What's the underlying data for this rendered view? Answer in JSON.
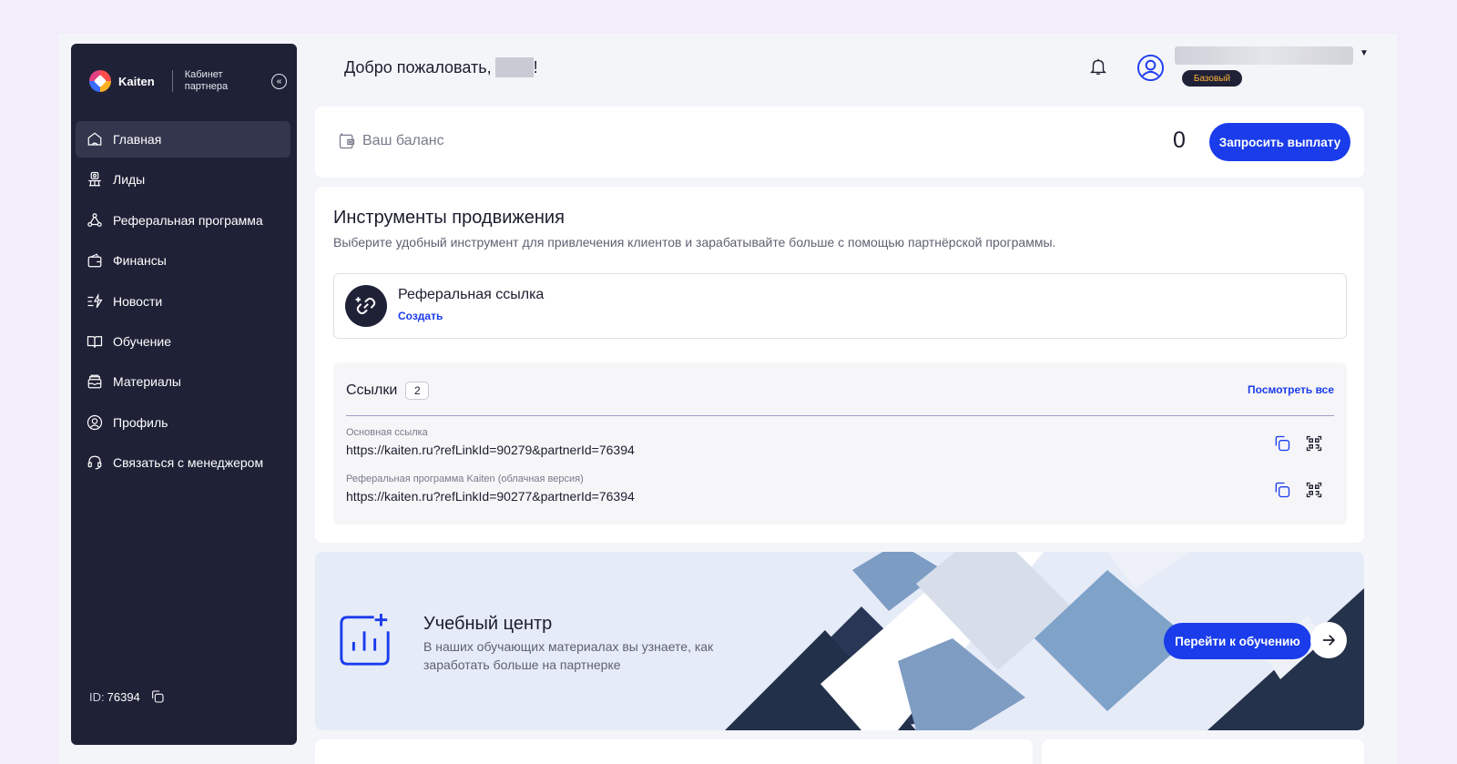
{
  "brand": {
    "name": "Kaiten",
    "subtitle": "Кабинет партнера"
  },
  "sidebar": {
    "items": [
      {
        "label": "Главная",
        "icon": "home-icon"
      },
      {
        "label": "Лиды",
        "icon": "leads-icon"
      },
      {
        "label": "Реферальная программа",
        "icon": "referral-icon"
      },
      {
        "label": "Финансы",
        "icon": "wallet-icon"
      },
      {
        "label": "Новости",
        "icon": "news-icon"
      },
      {
        "label": "Обучение",
        "icon": "book-icon"
      },
      {
        "label": "Материалы",
        "icon": "materials-icon"
      },
      {
        "label": "Профиль",
        "icon": "profile-icon"
      },
      {
        "label": "Связаться с менеджером",
        "icon": "headset-icon"
      }
    ],
    "id_label": "ID:",
    "id_value": "76394"
  },
  "header": {
    "welcome": "Добро пожаловать,",
    "welcome_suffix": "!",
    "plan": "Базовый"
  },
  "balance": {
    "label": "Ваш баланс",
    "value": "0",
    "payout_button": "Запросить выплату"
  },
  "tools": {
    "title": "Инструменты продвижения",
    "subtitle": "Выберите удобный инструмент для привлечения клиентов и зарабатывайте больше с помощью партнёрской программы.",
    "referral_link": {
      "title": "Реферальная ссылка",
      "action": "Создать"
    },
    "links": {
      "title": "Ссылки",
      "count": "2",
      "view_all": "Посмотреть все",
      "rows": [
        {
          "label": "Основная ссылка",
          "url": "https://kaiten.ru?refLinkId=90279&partnerId=76394"
        },
        {
          "label": "Реферальная программа Kaiten (облачная версия)",
          "url": "https://kaiten.ru?refLinkId=90277&partnerId=76394"
        }
      ]
    }
  },
  "learning": {
    "title": "Учебный центр",
    "description": "В наших обучающих материалах вы узнаете, как заработать больше на партнерке",
    "button": "Перейти к обучению"
  },
  "colors": {
    "accent": "#1a3ceb",
    "sidebar": "#1f2137",
    "badge_text": "#ffb33b"
  }
}
